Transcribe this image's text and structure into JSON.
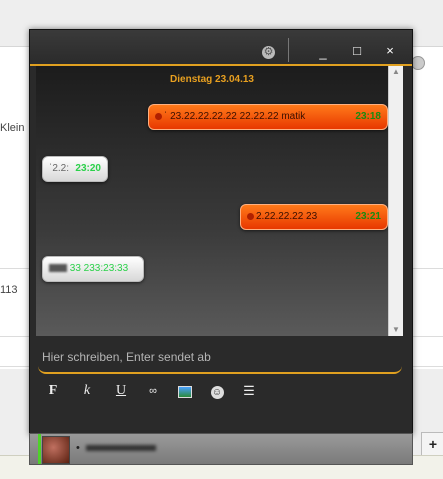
{
  "background_page": {
    "left_text_1": "Klein",
    "left_text_2": "113"
  },
  "window": {
    "title_buttons": {
      "settings": "⚙",
      "minimize": "_",
      "maximize": "□",
      "close": "×"
    },
    "date_separator": "Dienstag 23.04.13",
    "messages": [
      {
        "direction": "out",
        "text": "ˈ 23.22.22.22.22 22.22.22 matik",
        "time": "23:18"
      },
      {
        "direction": "in",
        "text": "ˈ2.2:",
        "time": "23:20"
      },
      {
        "direction": "out",
        "text": "2.22.22.22 23",
        "time": "23:21"
      },
      {
        "direction": "in",
        "text": "33 233:23:33",
        "time": ""
      }
    ],
    "input": {
      "placeholder": "Hier schreiben, Enter sendet ab",
      "value": ""
    },
    "toolbar": {
      "bold": "F",
      "italic": "k",
      "underline": "U",
      "link": "∞",
      "image": "image-icon",
      "smiley": "☺",
      "menu": "☰"
    }
  },
  "contact": {
    "name": "•",
    "status_color": "#4fd12a"
  },
  "side_button": "+",
  "colors": {
    "accent": "#e0a020",
    "out_bubble": "#ff5a0a",
    "time_green": "#2bd14a"
  }
}
